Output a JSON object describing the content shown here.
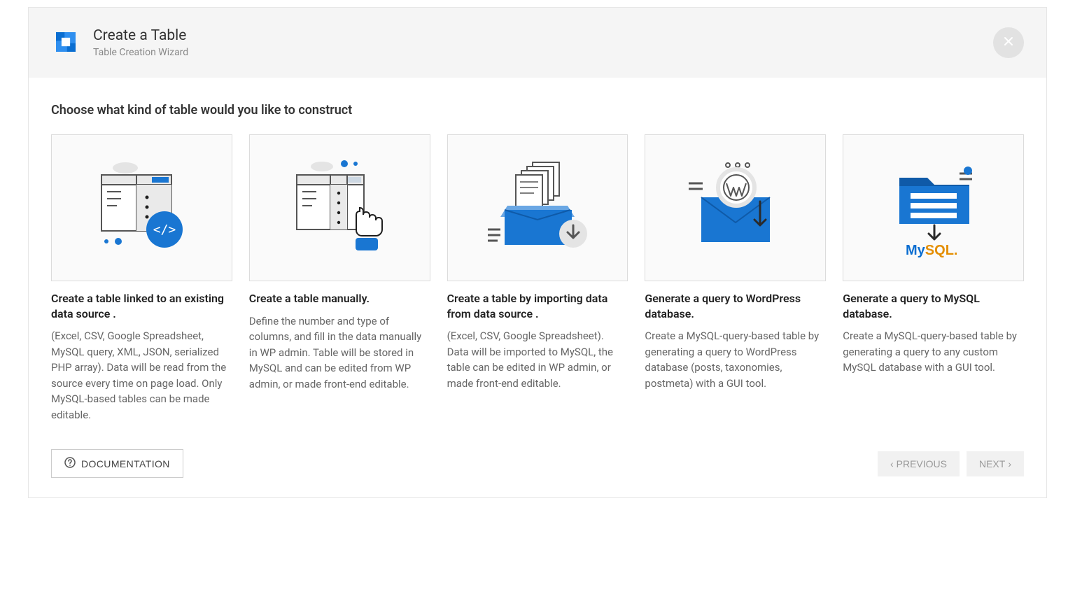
{
  "header": {
    "title": "Create a Table",
    "subtitle": "Table Creation Wizard"
  },
  "body": {
    "prompt": "Choose what kind of table would you like to construct"
  },
  "options": [
    {
      "title": "Create a table linked to an existing data source .",
      "desc": "(Excel, CSV, Google Spreadsheet, MySQL query, XML, JSON, serialized PHP array). Data will be read from the source every time on page load. Only MySQL-based tables can be made editable."
    },
    {
      "title": "Create a table manually.",
      "desc": "Define the number and type of columns, and fill in the data manually in WP admin. Table will be stored in MySQL and can be edited from WP admin, or made front-end editable."
    },
    {
      "title": "Create a table by importing data from data source .",
      "desc": "(Excel, CSV, Google Spreadsheet). Data will be imported to MySQL, the table can be edited in WP admin, or made front-end editable."
    },
    {
      "title": "Generate a query to WordPress database.",
      "desc": "Create a MySQL-query-based table by generating a query to WordPress database (posts, taxonomies, postmeta) with a GUI tool."
    },
    {
      "title": "Generate a query to MySQL database.",
      "desc": "Create a MySQL-query-based table by generating a query to any custom MySQL database with a GUI tool."
    }
  ],
  "footer": {
    "documentation": "DOCUMENTATION",
    "previous": "PREVIOUS",
    "next": "NEXT"
  }
}
